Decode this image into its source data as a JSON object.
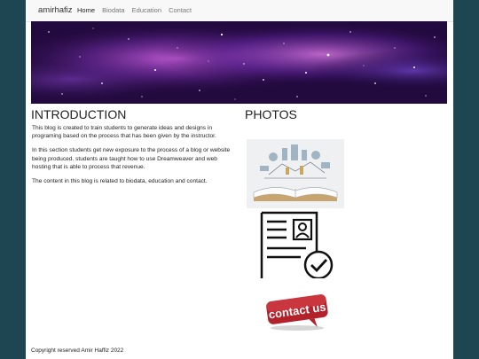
{
  "navbar": {
    "brand": "amirhafiz",
    "links": [
      {
        "label": "Home",
        "active": true
      },
      {
        "label": "Biodata",
        "active": false
      },
      {
        "label": "Education",
        "active": false
      },
      {
        "label": "Contact",
        "active": false
      }
    ]
  },
  "banner": {
    "theme": "purple galaxy starfield"
  },
  "intro": {
    "title": "INTRODUCTION",
    "paragraphs": [
      "This blog is created to train students to generate ideas and designs in programing based on the process that has been given by the instructor.",
      "In this section students get new exposure to the process of a blog or website being produced. students are taught how to use Dreamweaver and web hosting that is able to process that revenue.",
      "The content in this blog is related to biodata, education and contact."
    ]
  },
  "photos": {
    "title": "PHOTOS",
    "items": [
      {
        "icon": "open-book-ideas-image"
      },
      {
        "icon": "resume-check-icon"
      },
      {
        "icon": "contact-us-button-image",
        "text": "contact us"
      }
    ]
  },
  "footer": {
    "text": "Copyright reserved Amir Haffiz 2022"
  },
  "colors": {
    "page_bg": "#1d4552",
    "content_bg": "#ffffff",
    "contact_red": "#c0242b"
  }
}
